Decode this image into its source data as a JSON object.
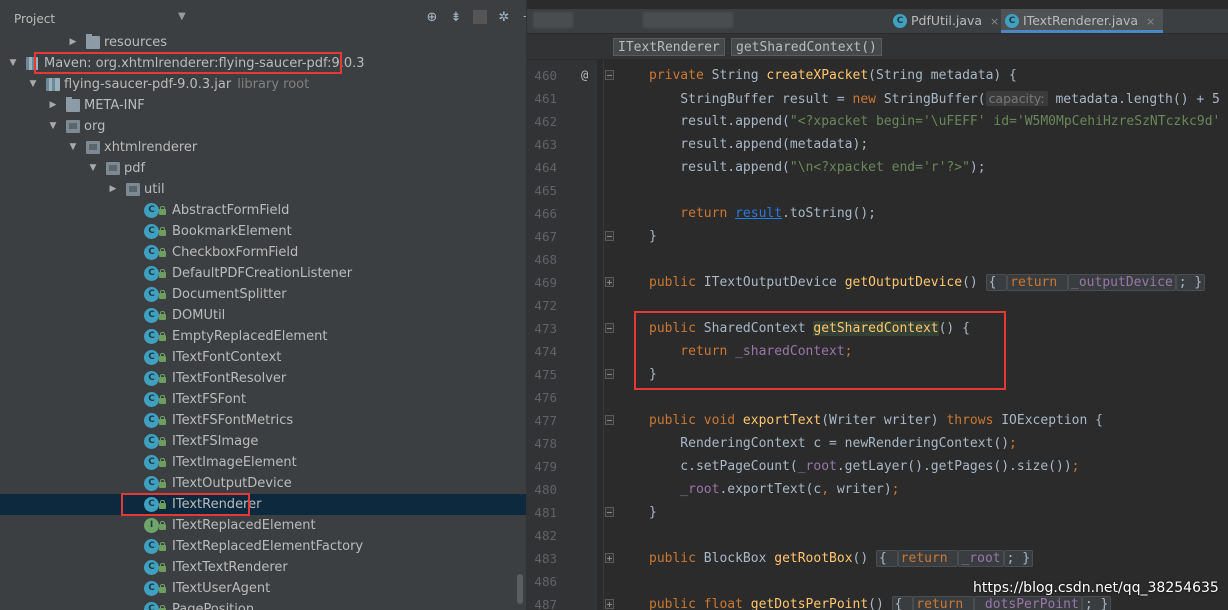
{
  "project_pane": {
    "title": "Project",
    "dropdown_icon": "chevron-down-icon",
    "tools": [
      "locate-icon",
      "collapse-icon",
      "gear-icon",
      "hide-icon"
    ],
    "tree": [
      {
        "label": "resources",
        "depth": 3,
        "icon": "folder-icon",
        "arrow": "collapsed"
      },
      {
        "label": "Maven: org.xhtmlrenderer:flying-saucer-pdf:9.0.3",
        "depth": 0,
        "icon": "library-icon",
        "arrow": "expanded"
      },
      {
        "label": "flying-saucer-pdf-9.0.3.jar",
        "sub": "library root",
        "depth": 1,
        "icon": "jar-icon",
        "arrow": "expanded"
      },
      {
        "label": "META-INF",
        "depth": 2,
        "icon": "folder-icon",
        "arrow": "collapsed"
      },
      {
        "label": "org",
        "depth": 2,
        "icon": "package-icon",
        "arrow": "expanded"
      },
      {
        "label": "xhtmlrenderer",
        "depth": 3,
        "icon": "package-icon",
        "arrow": "expanded"
      },
      {
        "label": "pdf",
        "depth": 4,
        "icon": "package-icon",
        "arrow": "expanded"
      },
      {
        "label": "util",
        "depth": 5,
        "icon": "package-icon",
        "arrow": "collapsed"
      },
      {
        "label": "AbstractFormField",
        "depth": 6,
        "icon": "class-icon"
      },
      {
        "label": "BookmarkElement",
        "depth": 6,
        "icon": "class-icon"
      },
      {
        "label": "CheckboxFormField",
        "depth": 6,
        "icon": "class-icon"
      },
      {
        "label": "DefaultPDFCreationListener",
        "depth": 6,
        "icon": "class-icon"
      },
      {
        "label": "DocumentSplitter",
        "depth": 6,
        "icon": "class-icon"
      },
      {
        "label": "DOMUtil",
        "depth": 6,
        "icon": "class-icon"
      },
      {
        "label": "EmptyReplacedElement",
        "depth": 6,
        "icon": "class-icon"
      },
      {
        "label": "ITextFontContext",
        "depth": 6,
        "icon": "class-icon"
      },
      {
        "label": "ITextFontResolver",
        "depth": 6,
        "icon": "class-icon"
      },
      {
        "label": "ITextFSFont",
        "depth": 6,
        "icon": "class-icon"
      },
      {
        "label": "ITextFSFontMetrics",
        "depth": 6,
        "icon": "class-icon"
      },
      {
        "label": "ITextFSImage",
        "depth": 6,
        "icon": "class-icon"
      },
      {
        "label": "ITextImageElement",
        "depth": 6,
        "icon": "class-icon"
      },
      {
        "label": "ITextOutputDevice",
        "depth": 6,
        "icon": "class-icon"
      },
      {
        "label": "ITextRenderer",
        "depth": 6,
        "icon": "class-icon",
        "selected": true
      },
      {
        "label": "ITextReplacedElement",
        "depth": 6,
        "icon": "interface-icon"
      },
      {
        "label": "ITextReplacedElementFactory",
        "depth": 6,
        "icon": "class-icon"
      },
      {
        "label": "ITextTextRenderer",
        "depth": 6,
        "icon": "class-icon"
      },
      {
        "label": "ITextUserAgent",
        "depth": 6,
        "icon": "class-icon"
      },
      {
        "label": "PagePosition",
        "depth": 6,
        "icon": "class-icon"
      }
    ]
  },
  "editor": {
    "tabs": [
      {
        "label": "PdfUtil.java",
        "icon": "class-icon",
        "active": false
      },
      {
        "label": "ITextRenderer.java",
        "icon": "class-icon",
        "active": true
      }
    ],
    "close_glyph": "×",
    "breadcrumb": [
      "ITextRenderer",
      "getSharedContext()"
    ],
    "override_marker": "@",
    "lines": [
      {
        "n": "460",
        "fold": "minus",
        "mark": "@",
        "html_key": "l460"
      },
      {
        "n": "461",
        "html_key": "l461"
      },
      {
        "n": "462",
        "html_key": "l462"
      },
      {
        "n": "463",
        "html_key": "l463"
      },
      {
        "n": "464",
        "html_key": "l464"
      },
      {
        "n": "465",
        "html_key": "empty"
      },
      {
        "n": "466",
        "html_key": "l466"
      },
      {
        "n": "467",
        "fold": "minus",
        "html_key": "l467"
      },
      {
        "n": "468",
        "html_key": "empty"
      },
      {
        "n": "469",
        "fold": "plus",
        "html_key": "l469"
      },
      {
        "n": "472",
        "html_key": "empty"
      },
      {
        "n": "473",
        "fold": "minus",
        "html_key": "l473"
      },
      {
        "n": "474",
        "html_key": "l474"
      },
      {
        "n": "475",
        "fold": "minus",
        "html_key": "l475"
      },
      {
        "n": "476",
        "html_key": "empty"
      },
      {
        "n": "477",
        "fold": "minus",
        "html_key": "l477"
      },
      {
        "n": "478",
        "html_key": "l478"
      },
      {
        "n": "479",
        "html_key": "l479"
      },
      {
        "n": "480",
        "html_key": "l480"
      },
      {
        "n": "481",
        "fold": "minus",
        "html_key": "l481"
      },
      {
        "n": "482",
        "html_key": "empty"
      },
      {
        "n": "483",
        "fold": "plus",
        "html_key": "l483"
      },
      {
        "n": "486",
        "html_key": "empty"
      },
      {
        "n": "487",
        "fold": "plus",
        "html_key": "l487"
      }
    ],
    "code": {
      "l460": [
        [
          "kw",
          "private "
        ],
        [
          "",
          "String "
        ],
        [
          "fn",
          "createXPacket"
        ],
        [
          "",
          "(String metadata) {"
        ]
      ],
      "l461": [
        [
          "",
          "    StringBuffer result = "
        ],
        [
          "kw",
          "new "
        ],
        [
          "",
          "StringBuffer("
        ],
        [
          "hint",
          "capacity:"
        ],
        [
          "",
          " metadata.length() + 5"
        ]
      ],
      "l462": [
        [
          "",
          "    result.append("
        ],
        [
          "str",
          "\"<?xpacket begin='\\uFEFF' id='W5M0MpCehiHzreSzNTczkc9d'"
        ]
      ],
      "l463": [
        [
          "",
          "    result.append(metadata);"
        ]
      ],
      "l464": [
        [
          "",
          "    result.append("
        ],
        [
          "str",
          "\"\\n<?xpacket end='r'?>\""
        ],
        [
          "",
          ");"
        ]
      ],
      "empty": [
        [
          "",
          ""
        ]
      ],
      "l466": [
        [
          "kw",
          "    return "
        ],
        [
          "uline",
          "result"
        ],
        [
          "",
          ".toString();"
        ]
      ],
      "l467": [
        [
          "",
          "}"
        ]
      ],
      "l469": [
        [
          "kw",
          "public "
        ],
        [
          "",
          "ITextOutputDevice "
        ],
        [
          "fn",
          "getOutputDevice"
        ],
        [
          "",
          "() "
        ],
        [
          "pill",
          "{ "
        ],
        [
          "kwp",
          "return "
        ],
        [
          "fldp",
          "_outputDevice"
        ],
        [
          "pill",
          "; }"
        ]
      ],
      "l473": [
        [
          "kw",
          "public "
        ],
        [
          "",
          "SharedContext "
        ],
        [
          "fnsel",
          "getSharedContext"
        ],
        [
          "",
          "() {"
        ]
      ],
      "l474": [
        [
          "kw",
          "    return "
        ],
        [
          "fld",
          "_sharedContext"
        ],
        [
          "kw",
          ";"
        ]
      ],
      "l475": [
        [
          "",
          "}"
        ]
      ],
      "l477": [
        [
          "kw",
          "public void "
        ],
        [
          "fn",
          "exportText"
        ],
        [
          "",
          "(Writer writer) "
        ],
        [
          "kw",
          "throws "
        ],
        [
          "",
          "IOException {"
        ]
      ],
      "l478": [
        [
          "",
          "    RenderingContext c = newRenderingContext()"
        ],
        [
          "kw",
          ";"
        ]
      ],
      "l479": [
        [
          "",
          "    c.setPageCount("
        ],
        [
          "fld",
          "_root"
        ],
        [
          "",
          ".getLayer().getPages().size())"
        ],
        [
          "kw",
          ";"
        ]
      ],
      "l480": [
        [
          "fld",
          "    _root"
        ],
        [
          "",
          ".exportText(c"
        ],
        [
          "kw",
          ", "
        ],
        [
          "",
          "writer)"
        ],
        [
          "kw",
          ";"
        ]
      ],
      "l481": [
        [
          "",
          "}"
        ]
      ],
      "l483": [
        [
          "kw",
          "public "
        ],
        [
          "",
          "BlockBox "
        ],
        [
          "fn",
          "getRootBox"
        ],
        [
          "",
          "() "
        ],
        [
          "pill",
          "{ "
        ],
        [
          "kwp",
          "return "
        ],
        [
          "fldp",
          "_root"
        ],
        [
          "pill",
          "; }"
        ]
      ],
      "l487": [
        [
          "kw",
          "public float "
        ],
        [
          "fn",
          "getDotsPerPoint"
        ],
        [
          "",
          "() "
        ],
        [
          "pill",
          "{ "
        ],
        [
          "kwp",
          "return "
        ],
        [
          "fldp",
          "_dotsPerPoint"
        ],
        [
          "pill",
          "; }"
        ]
      ]
    }
  },
  "watermark": "https://blog.csdn.net/qq_38254635"
}
